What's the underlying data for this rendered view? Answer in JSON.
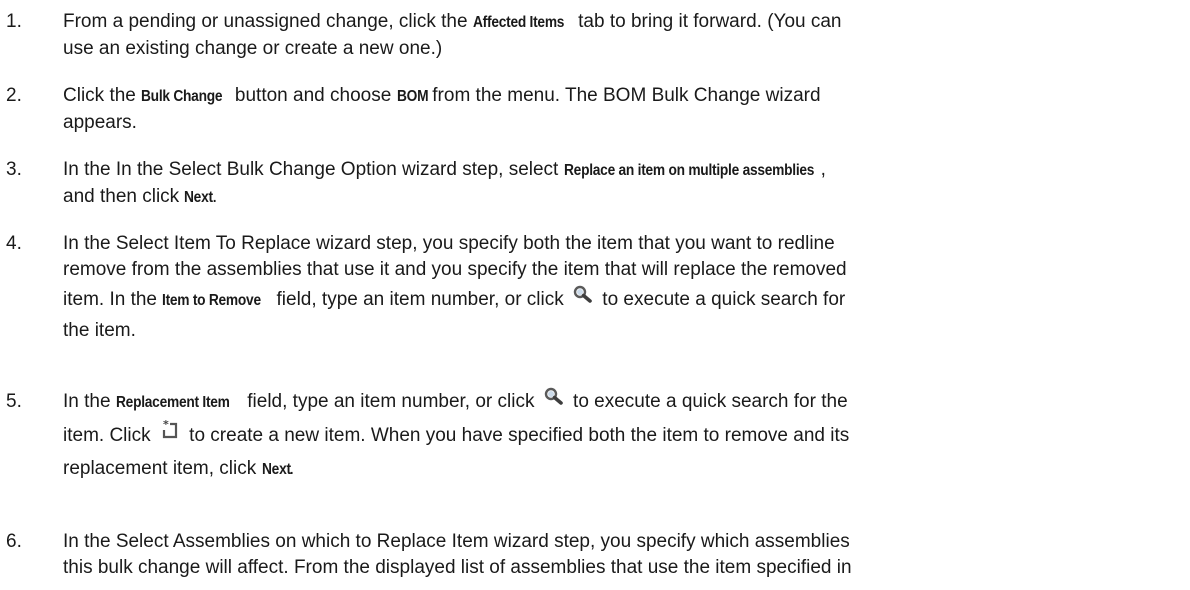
{
  "steps": [
    {
      "number": "1.",
      "t1": "From a pending or unassigned change, click the ",
      "b1": "Affected Items",
      "t2": " tab to bring it forward. (You can",
      "t3": "use an existing change or create a new one.)"
    },
    {
      "number": "2.",
      "t1": "Click the ",
      "b1": "Bulk Change",
      "t2": " button and choose ",
      "b2": "BOM",
      "t3": " from the menu. The BOM Bulk Change wizard",
      "t4": "appears."
    },
    {
      "number": "3.",
      "t1": "In the In the Select Bulk Change Option wizard step, select ",
      "b1": "Replace an item on multiple assemblies",
      "t2": ",",
      "t3": "and then click ",
      "b2": "Next",
      "t4": "."
    },
    {
      "number": "4.",
      "t1": "In the Select Item To Replace wizard step, you specify both the item that you want to redline",
      "t2": "remove from the assemblies that use it and you specify the item that will replace the removed",
      "t3": "item. In the ",
      "b1": "Item to Remove",
      "t4": " field, type an item number, or click ",
      "t5": " to execute a quick search for",
      "t6": "the item."
    },
    {
      "number": "5.",
      "t1": "In the ",
      "b1": "Replacement Item",
      "t2": " field, type an item number, or click ",
      "t3": " to execute a quick search for the",
      "t4": "item. Click ",
      "t5": " to create a new item. When you have specified both the item to remove and its",
      "t6": "replacement item, click ",
      "b2": "Next",
      "t7": "."
    },
    {
      "number": "6.",
      "t1": "In the Select Assemblies on which to Replace Item wizard step, you specify which assemblies",
      "t2": "this bulk change will affect. From the displayed list of assemblies that use the item specified in"
    }
  ],
  "icons": {
    "search": "magnifier-search-icon",
    "new_item": "new-item-icon"
  }
}
